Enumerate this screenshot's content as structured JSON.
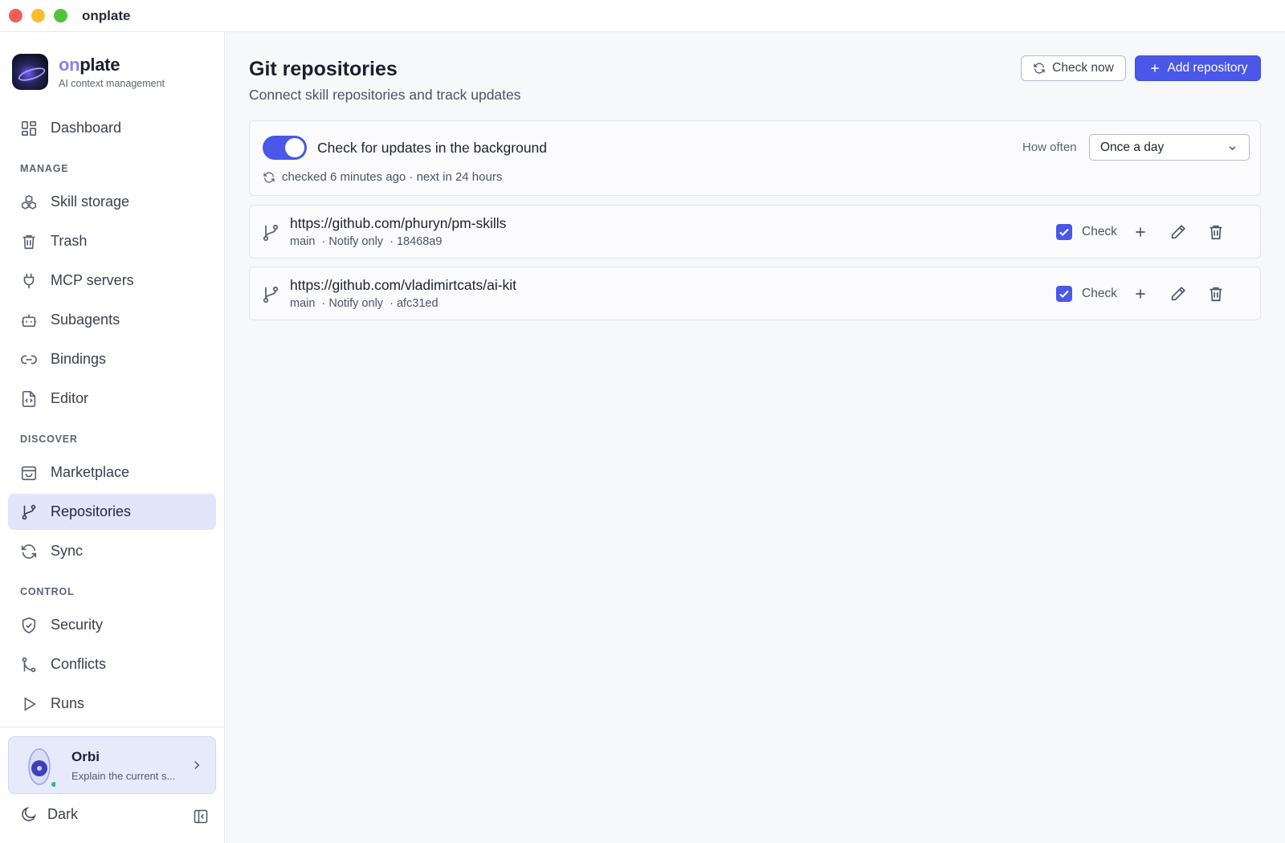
{
  "window": {
    "title": "onplate"
  },
  "brand": {
    "name_prefix": "on",
    "name_suffix": "plate",
    "subtitle": "AI context management"
  },
  "sidebar": {
    "dashboard": "Dashboard",
    "sections": {
      "manage": "MANAGE",
      "discover": "DISCOVER",
      "control": "CONTROL"
    },
    "items": {
      "skill_storage": "Skill storage",
      "trash": "Trash",
      "mcp_servers": "MCP servers",
      "subagents": "Subagents",
      "bindings": "Bindings",
      "editor": "Editor",
      "marketplace": "Marketplace",
      "repositories": "Repositories",
      "sync": "Sync",
      "security": "Security",
      "conflicts": "Conflicts",
      "runs": "Runs"
    },
    "active_item": "Repositories",
    "assistant": {
      "name": "Orbi",
      "description": "Explain the current s..."
    },
    "theme_toggle": "Dark"
  },
  "main": {
    "title": "Git repositories",
    "subtitle": "Connect skill repositories and track updates",
    "check_now": "Check now",
    "add_repository": "Add repository",
    "background": {
      "enabled": true,
      "label": "Check for updates in the background",
      "status": "checked 6 minutes ago · next in 24 hours",
      "how_often_label": "How often",
      "how_often_value": "Once a day"
    },
    "repositories": [
      {
        "url": "https://github.com/phuryn/pm-skills",
        "meta": "main  · Notify only  · 18468a9",
        "checked": true,
        "check_label": "Check"
      },
      {
        "url": "https://github.com/vladimirtcats/ai-kit",
        "meta": "main  · Notify only  · afc31ed",
        "checked": true,
        "check_label": "Check"
      }
    ]
  },
  "colors": {
    "accent": "#4a57e8",
    "active_nav_bg": "#e3e6fb"
  }
}
